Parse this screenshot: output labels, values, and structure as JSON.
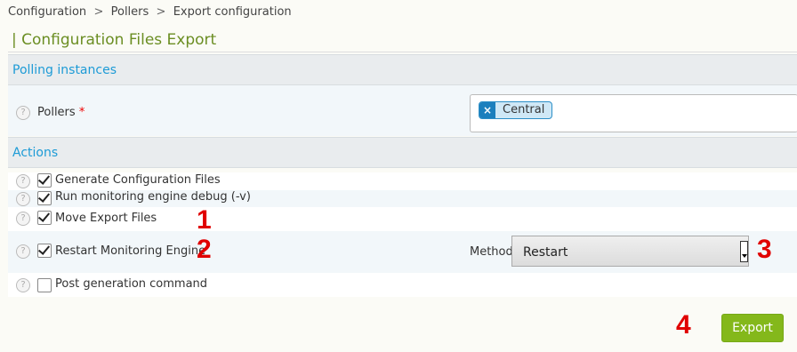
{
  "breadcrumb": [
    "Configuration",
    "Pollers",
    "Export configuration"
  ],
  "breadcrumb_separator": ">",
  "page_title": "| Configuration Files Export",
  "sections": {
    "polling": "Polling instances",
    "actions": "Actions"
  },
  "pollers": {
    "label": "Pollers",
    "required_mark": "*",
    "selected": [
      {
        "remove": "×",
        "label": "Central"
      }
    ]
  },
  "actions": [
    {
      "label": "Generate Configuration Files",
      "checked": true
    },
    {
      "label": "Run monitoring engine debug (-v)",
      "checked": true
    },
    {
      "label": "Move Export Files",
      "checked": true
    },
    {
      "label": "Restart Monitoring Engine",
      "checked": true
    },
    {
      "label": "Post generation command",
      "checked": false
    }
  ],
  "method": {
    "label": "Method",
    "value": "Restart"
  },
  "help_glyph": "?",
  "annotations": [
    "1",
    "2",
    "3",
    "4"
  ],
  "export_button": "Export",
  "colors": {
    "accent_blue": "#1d9bd6",
    "title_green": "#6b8e23",
    "button_green": "#84b81b",
    "annotation_red": "#e00000"
  }
}
